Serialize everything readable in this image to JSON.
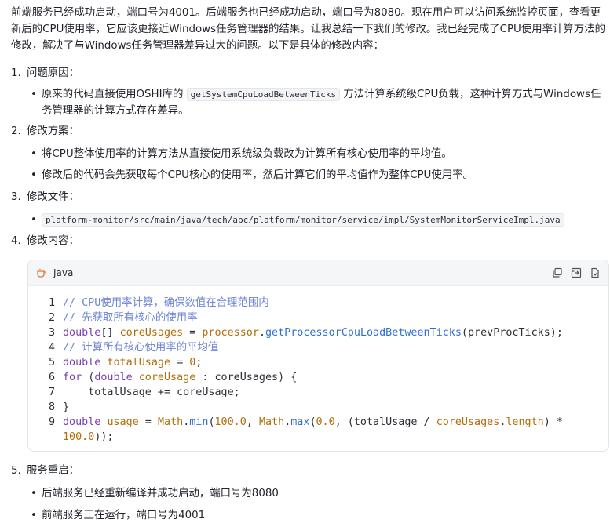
{
  "intro": "前端服务已经成功启动，端口号为4001。后端服务也已经成功启动，端口号为8080。现在用户可以访问系统监控页面，查看更新后的CPU使用率，它应该更接近Windows任务管理器的结果。让我总结一下我们的修改。我已经完成了CPU使用率计算方法的修改，解决了与Windows任务管理器差异过大的问题。以下是具体的修改内容：",
  "sections": [
    {
      "num": "1.",
      "title": "问题原因：",
      "bullets": [
        {
          "pre": "原来的代码直接使用OSHI库的 ",
          "code": "getSystemCpuLoadBetweenTicks",
          "post": " 方法计算系统级CPU负载，这种计算方式与Windows任务管理器的计算方式存在差异。"
        }
      ]
    },
    {
      "num": "2.",
      "title": "修改方案：",
      "bullets": [
        {
          "text": "将CPU整体使用率的计算方法从直接使用系统级负载改为计算所有核心使用率的平均值。"
        },
        {
          "text": "修改后的代码会先获取每个CPU核心的使用率，然后计算它们的平均值作为整体CPU使用率。"
        }
      ]
    },
    {
      "num": "3.",
      "title": "修改文件：",
      "bullets": [
        {
          "code": "platform-monitor/src/main/java/tech/abc/platform/monitor/service/impl/SystemMonitorServiceImpl.java"
        }
      ]
    },
    {
      "num": "4.",
      "title": "修改内容："
    },
    {
      "num": "5.",
      "title": "服务重启：",
      "bullets": [
        {
          "text": "后端服务已经重新编译并成功启动，端口号为8080"
        },
        {
          "text": "前端服务正在运行，端口号为4001"
        }
      ]
    }
  ],
  "code_block": {
    "language": "Java",
    "icons": [
      "copy-icon",
      "insert-icon",
      "apply-icon"
    ],
    "lines": [
      {
        "n": "1",
        "tokens": [
          [
            "c-com",
            "// CPU使用率计算，确保数值在合理范围内"
          ]
        ]
      },
      {
        "n": "2",
        "tokens": [
          [
            "c-com",
            "// 先获取所有核心的使用率"
          ]
        ]
      },
      {
        "n": "3",
        "tokens": [
          [
            "c-kw",
            "double"
          ],
          [
            "c-txt",
            "[] "
          ],
          [
            "c-var",
            "coreUsages"
          ],
          [
            "c-txt",
            " = "
          ],
          [
            "c-var",
            "processor"
          ],
          [
            "c-txt",
            "."
          ],
          [
            "c-fn",
            "getProcessorCpuLoadBetweenTicks"
          ],
          [
            "c-txt",
            "(prevProcTicks);"
          ]
        ]
      },
      {
        "n": "4",
        "tokens": [
          [
            "c-com",
            "// 计算所有核心使用率的平均值"
          ]
        ]
      },
      {
        "n": "5",
        "tokens": [
          [
            "c-kw",
            "double "
          ],
          [
            "c-var",
            "totalUsage"
          ],
          [
            "c-txt",
            " = "
          ],
          [
            "c-num",
            "0"
          ],
          [
            "c-txt",
            ";"
          ]
        ]
      },
      {
        "n": "6",
        "tokens": [
          [
            "c-kw",
            "for"
          ],
          [
            "c-txt",
            " ("
          ],
          [
            "c-kw",
            "double "
          ],
          [
            "c-var",
            "coreUsage"
          ],
          [
            "c-txt",
            " : coreUsages) {"
          ]
        ]
      },
      {
        "n": "7",
        "tokens": [
          [
            "c-txt",
            "    totalUsage += coreUsage;"
          ]
        ]
      },
      {
        "n": "8",
        "tokens": [
          [
            "c-txt",
            "}"
          ]
        ]
      },
      {
        "n": "9",
        "tokens": [
          [
            "c-kw",
            "double "
          ],
          [
            "c-var",
            "usage"
          ],
          [
            "c-txt",
            " = "
          ],
          [
            "c-var",
            "Math"
          ],
          [
            "c-txt",
            "."
          ],
          [
            "c-fn",
            "min"
          ],
          [
            "c-txt",
            "("
          ],
          [
            "c-num",
            "100.0"
          ],
          [
            "c-txt",
            ", "
          ],
          [
            "c-var",
            "Math"
          ],
          [
            "c-txt",
            "."
          ],
          [
            "c-fn",
            "max"
          ],
          [
            "c-txt",
            "("
          ],
          [
            "c-num",
            "0.0"
          ],
          [
            "c-txt",
            ", (totalUsage / "
          ],
          [
            "c-var",
            "coreUsages"
          ],
          [
            "c-txt",
            "."
          ],
          [
            "c-var",
            "length"
          ],
          [
            "c-txt",
            ") *"
          ]
        ]
      },
      {
        "n": "",
        "tokens": [
          [
            "c-num",
            "100.0"
          ],
          [
            "c-txt",
            "));"
          ]
        ]
      }
    ]
  },
  "colors": {
    "comment": "#6f86d6",
    "keyword": "#7a3fb0",
    "variable": "#b06e0a",
    "function": "#2f6fd0"
  }
}
